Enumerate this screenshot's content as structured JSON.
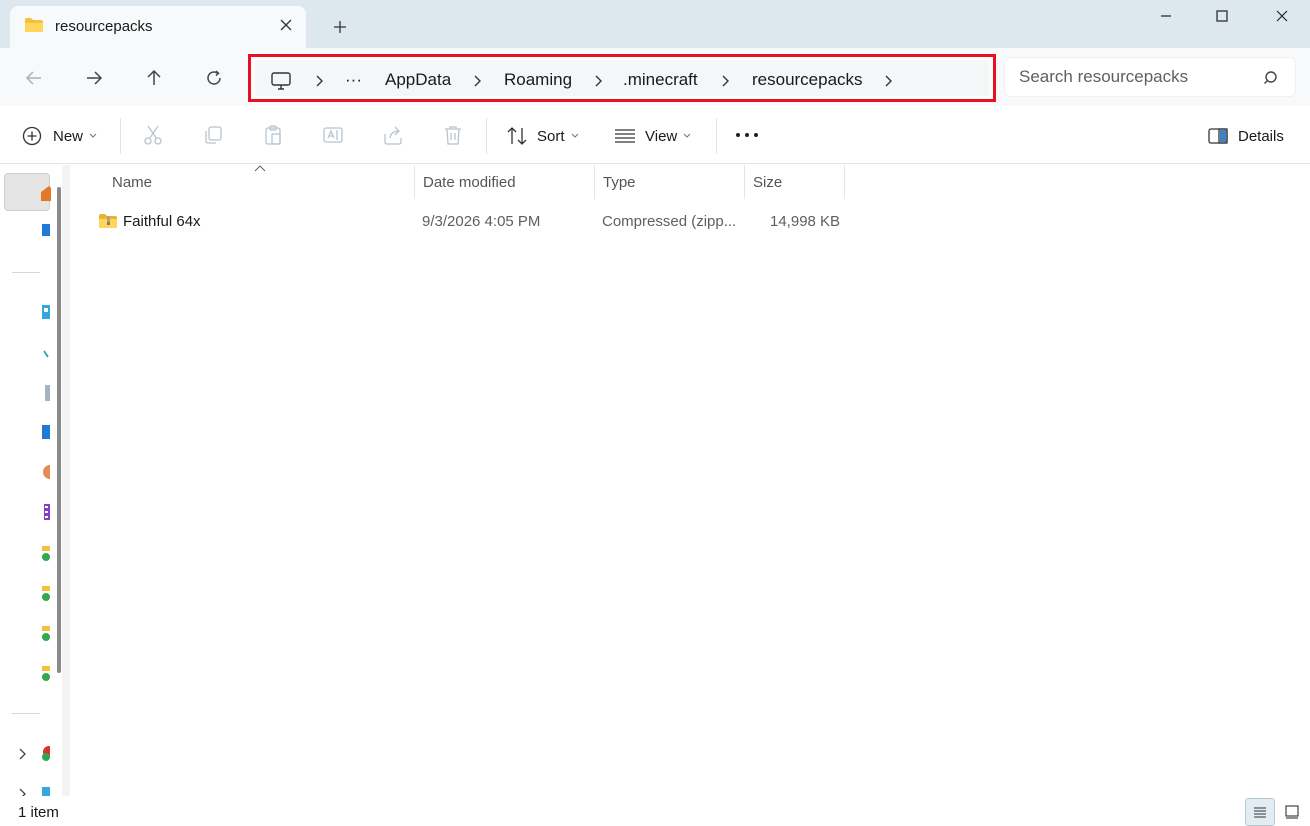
{
  "window": {
    "tab_title": "resourcepacks",
    "icons": {
      "tab": "folder-icon",
      "close_tab": "close-icon",
      "new_tab": "plus-icon",
      "minimize": "minimize-icon",
      "maximize": "maximize-icon",
      "close": "close-icon"
    }
  },
  "navigation": {
    "icons": {
      "back": "arrow-left-icon",
      "forward": "arrow-right-icon",
      "up": "arrow-up-icon",
      "refresh": "refresh-icon"
    }
  },
  "address": {
    "overflow": "···",
    "crumbs": [
      "AppData",
      "Roaming",
      ".minecraft",
      "resourcepacks"
    ],
    "highlight_color": "#e81123",
    "icons": {
      "root": "this-pc-icon",
      "separator": "chevron-right-icon"
    }
  },
  "search": {
    "placeholder": "Search resourcepacks",
    "icon": "search-icon"
  },
  "toolbar": {
    "new_label": "New",
    "sort_label": "Sort",
    "view_label": "View",
    "details_label": "Details",
    "icons": [
      "plus-circle-icon",
      "cut-icon",
      "copy-icon",
      "paste-icon",
      "rename-icon",
      "share-icon",
      "delete-icon",
      "sort-icon",
      "view-icon",
      "more-icon",
      "details-pane-icon"
    ]
  },
  "columns": {
    "name": "Name",
    "date": "Date modified",
    "type": "Type",
    "size": "Size"
  },
  "files": [
    {
      "name": "Faithful 64x",
      "date": "9/3/2026 4:05 PM",
      "type": "Compressed (zipp...",
      "size": "14,998 KB",
      "icon": "zip-folder-icon"
    }
  ],
  "status": {
    "count": "1 item"
  },
  "view_modes": [
    "details-view-icon",
    "tiles-view-icon"
  ]
}
